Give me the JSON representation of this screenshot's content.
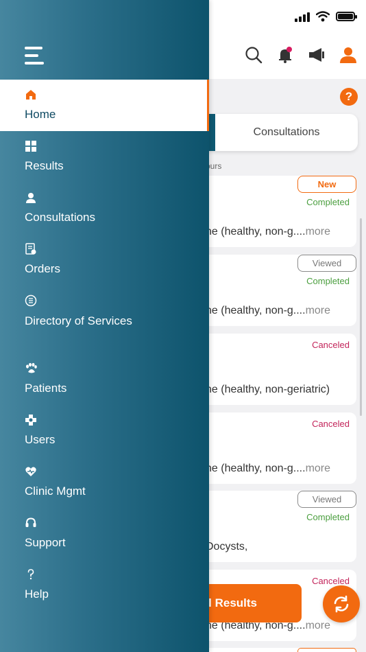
{
  "drawer": {
    "menu_items": [
      {
        "label": "Home",
        "icon": "home-icon",
        "active": true
      },
      {
        "label": "Results",
        "icon": "results-grid-icon"
      },
      {
        "label": "Consultations",
        "icon": "consultations-icon"
      },
      {
        "label": "Orders",
        "icon": "orders-icon"
      },
      {
        "label": "Directory of Services",
        "icon": "directory-icon"
      },
      {
        "label": "Patients",
        "icon": "paw-icon"
      },
      {
        "label": "Users",
        "icon": "users-icon"
      },
      {
        "label": "Clinic Mgmt",
        "icon": "clinic-heart-icon"
      },
      {
        "label": "Support",
        "icon": "headset-icon"
      },
      {
        "label": "Help",
        "icon": "question-icon"
      }
    ]
  },
  "main": {
    "tabs": {
      "consultations": "Consultations"
    },
    "hours_label": "ours",
    "help_icon": "?",
    "cards": [
      {
        "badge": "New",
        "status": "Completed",
        "desc": "ne (healthy, non-g....",
        "more": "more"
      },
      {
        "badge": "Viewed",
        "status": "Completed",
        "desc": "ne (healthy, non-g....",
        "more": "more"
      },
      {
        "badge": "",
        "status": "Canceled",
        "desc": "ne (healthy, non-geriatric)",
        "more": ""
      },
      {
        "badge": "",
        "status": "Canceled",
        "desc": "ne (healthy, non-g....",
        "more": "more"
      },
      {
        "badge": "Viewed",
        "status": "Completed",
        "desc": "Docysts,",
        "more": ""
      },
      {
        "badge": "",
        "status": "Canceled",
        "desc": "ne (healthy, non-g....",
        "more": "more"
      }
    ],
    "results_button": "l Results"
  },
  "colors": {
    "accent": "#f26a10",
    "drawer_dark": "#0d536c",
    "drawer_light": "#46869f",
    "completed": "#4a9e3e",
    "canceled": "#c3245a"
  }
}
